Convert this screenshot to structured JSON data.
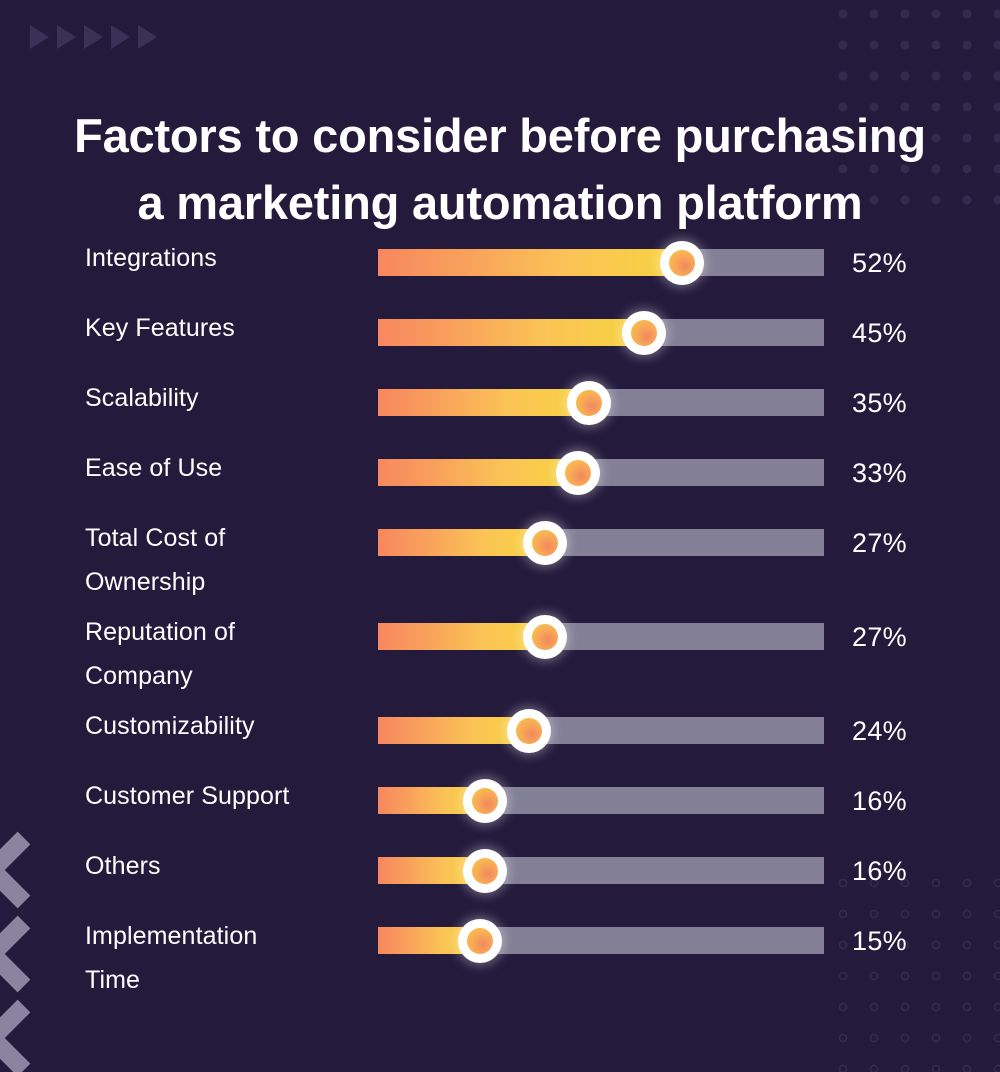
{
  "meta": {
    "background_color": "#241a3c",
    "accent_gradient_start": "#f8875f",
    "accent_gradient_end": "#f7d33f",
    "track_color": "#827f96",
    "decoration_color": "#3b3157",
    "text_color": "#ffffff"
  },
  "title": {
    "line1": "Factors to consider before purchasing",
    "line2": "a marketing automation platform"
  },
  "decorations": {
    "triangles": {
      "icon": "triangle-right-icon",
      "count": 5
    },
    "chevrons": {
      "icon": "chevron-left-icon",
      "count": 3
    },
    "dots_top_right": {
      "icon": "dot-grid-filled-icon"
    },
    "dots_bottom_right": {
      "icon": "dot-grid-outline-icon"
    }
  },
  "chart_data": {
    "type": "bar",
    "title": "Factors to consider before purchasing a marketing automation platform",
    "xlabel": "",
    "ylabel": "",
    "xlim": [
      0,
      100
    ],
    "unit": "%",
    "grid": false,
    "legend": "none",
    "orientation": "horizontal",
    "categories": [
      "Integrations",
      "Key Features",
      "Scalability",
      "Ease of Use",
      "Total Cost of\nOwnership",
      "Reputation of\nCompany",
      "Customizability",
      "Customer Support",
      "Others",
      "Implementation\nTime"
    ],
    "values": [
      52,
      45,
      35,
      33,
      27,
      27,
      24,
      16,
      16,
      15
    ],
    "value_labels": [
      "52%",
      "45%",
      "35%",
      "33%",
      "27%",
      "27%",
      "24%",
      "16%",
      "16%",
      "15%"
    ]
  },
  "rows": [
    {
      "label": "Integrations",
      "value": 52,
      "value_label": "52%",
      "tall": false
    },
    {
      "label": "Key Features",
      "value": 45,
      "value_label": "45%",
      "tall": false
    },
    {
      "label": "Scalability",
      "value": 35,
      "value_label": "35%",
      "tall": false
    },
    {
      "label": "Ease of Use",
      "value": 33,
      "value_label": "33%",
      "tall": false
    },
    {
      "label": "Total Cost of\nOwnership",
      "value": 27,
      "value_label": "27%",
      "tall": true
    },
    {
      "label": "Reputation of\nCompany",
      "value": 27,
      "value_label": "27%",
      "tall": true
    },
    {
      "label": "Customizability",
      "value": 24,
      "value_label": "24%",
      "tall": false
    },
    {
      "label": "Customer Support",
      "value": 16,
      "value_label": "16%",
      "tall": false
    },
    {
      "label": "Others",
      "value": 16,
      "value_label": "16%",
      "tall": false
    },
    {
      "label": "Implementation\nTime",
      "value": 15,
      "value_label": "15%",
      "tall": true
    }
  ]
}
